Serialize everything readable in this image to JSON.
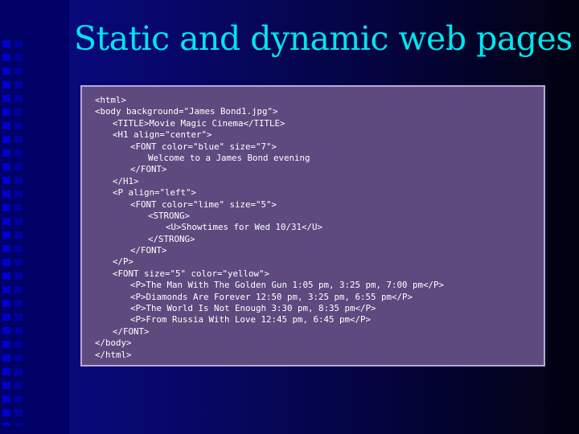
{
  "slide": {
    "title": "Static and dynamic web pages"
  },
  "code": {
    "lines": [
      {
        "indent": 0,
        "text": "<html>"
      },
      {
        "indent": 0,
        "text": "<body background=\"James Bond1.jpg\">"
      },
      {
        "indent": 1,
        "text": "<TITLE>Movie Magic Cinema</TITLE>"
      },
      {
        "indent": 1,
        "text": "<H1 align=\"center\">"
      },
      {
        "indent": 2,
        "text": "<FONT color=\"blue\" size=\"7\">"
      },
      {
        "indent": 3,
        "text": "Welcome to a James Bond evening"
      },
      {
        "indent": 2,
        "text": "</FONT>"
      },
      {
        "indent": 1,
        "text": "</H1>"
      },
      {
        "indent": 1,
        "text": "<P align=\"left\">"
      },
      {
        "indent": 2,
        "text": "<FONT color=\"lime\" size=\"5\">"
      },
      {
        "indent": 3,
        "text": "<STRONG>"
      },
      {
        "indent": 4,
        "text": "<U>Showtimes for Wed 10/31</U>"
      },
      {
        "indent": 3,
        "text": "</STRONG>"
      },
      {
        "indent": 2,
        "text": "</FONT>"
      },
      {
        "indent": 1,
        "text": "</P>"
      },
      {
        "indent": 1,
        "text": "<FONT size=\"5\" color=\"yellow\">"
      },
      {
        "indent": 2,
        "text": "<P>The Man With The Golden Gun 1:05 pm, 3:25 pm, 7:00 pm</P>"
      },
      {
        "indent": 2,
        "text": "<P>Diamonds Are Forever 12:50 pm, 3:25 pm, 6:55 pm</P>"
      },
      {
        "indent": 2,
        "text": "<P>The World Is Not Enough 3:30 pm, 8:35 pm</P>"
      },
      {
        "indent": 2,
        "text": "<P>From Russia With Love 12:45 pm, 6:45 pm</P>"
      },
      {
        "indent": 1,
        "text": "</FONT>"
      },
      {
        "indent": 0,
        "text": "</body>"
      },
      {
        "indent": 0,
        "text": "</html>"
      }
    ]
  },
  "colors": {
    "title": "#00e6ee",
    "box_background": "#5e4a7e",
    "box_border": "#b9a9d9",
    "code_text": "#ffffff"
  }
}
